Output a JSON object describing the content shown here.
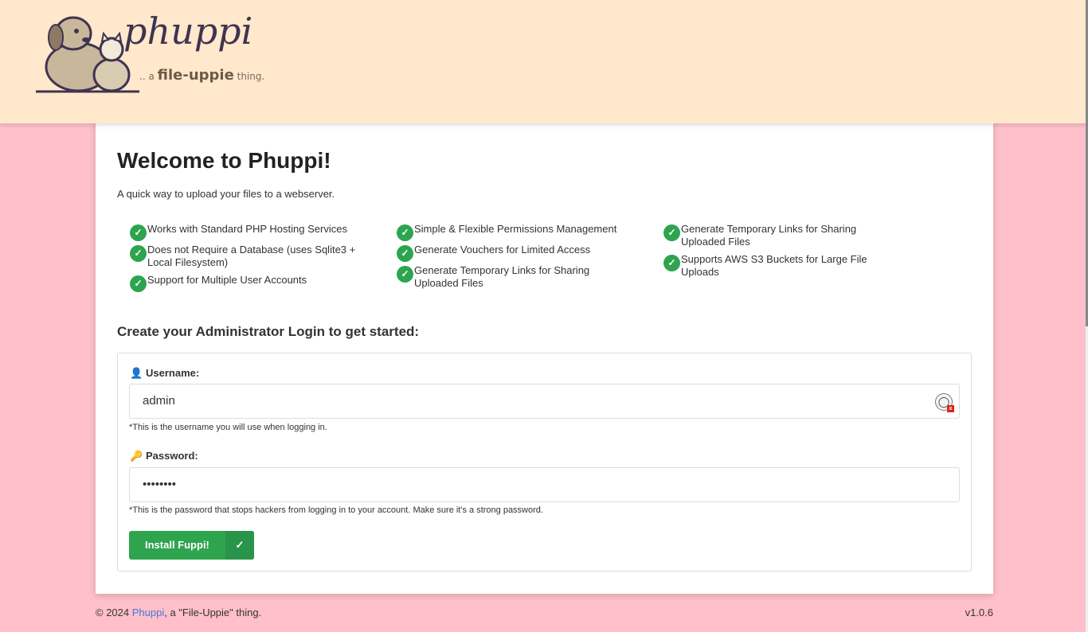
{
  "header": {
    "logo_text": "phuppi",
    "logo_tag_prefix": ".. a",
    "logo_tag_brand": "file-uppie",
    "logo_tag_suffix": "thing."
  },
  "main": {
    "title": "Welcome to Phuppi!",
    "subtitle": "A quick way to upload your files to a webserver.",
    "features": [
      [
        "Works with Standard PHP Hosting Services",
        "Does not Require a Database (uses Sqlite3 + Local Filesystem)",
        "Support for Multiple User Accounts"
      ],
      [
        "Simple & Flexible Permissions Management",
        "Generate Vouchers for Limited Access",
        "Generate Temporary Links for Sharing Uploaded Files"
      ],
      [
        "Generate Temporary Links for Sharing Uploaded Files",
        "Supports AWS S3 Buckets for Large File Uploads"
      ]
    ],
    "section_title": "Create your Administrator Login to get started:"
  },
  "form": {
    "username_label": "Username:",
    "username_value": "admin",
    "username_help": "*This is the username you will use when logging in.",
    "password_label": "Password:",
    "password_value": "••••••••",
    "password_help": "*This is the password that stops hackers from logging in to your account. Make sure it's a strong password.",
    "submit_label": "Install Fuppi!"
  },
  "footer": {
    "copyright_prefix": "© 2024",
    "brand_link": "Phuppi",
    "copyright_suffix": ", a \"File-Uppie\" thing.",
    "version": "v1.0.6"
  },
  "icons": {
    "check": "check-icon",
    "user": "user-icon",
    "key": "key-icon"
  },
  "colors": {
    "page_bg": "#ffc0cb",
    "header_bg": "#ffe8cc",
    "accent_green": "#2ea44f",
    "link": "#3f7ad6"
  }
}
